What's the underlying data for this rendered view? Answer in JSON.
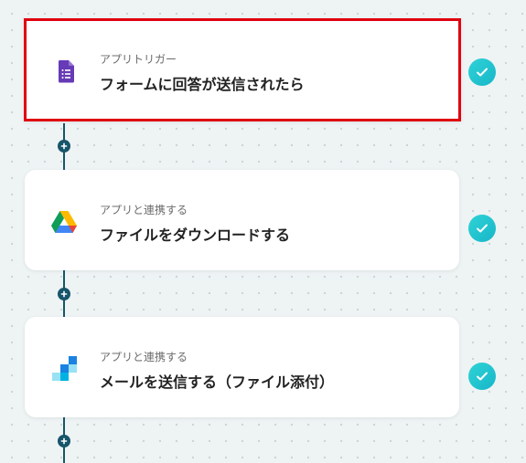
{
  "steps": [
    {
      "sub": "アプリトリガー",
      "title": "フォームに回答が送信されたら",
      "icon": "google-forms-icon",
      "status": "completed"
    },
    {
      "sub": "アプリと連携する",
      "title": "ファイルをダウンロードする",
      "icon": "google-drive-icon",
      "status": "completed"
    },
    {
      "sub": "アプリと連携する",
      "title": "メールを送信する（ファイル添付）",
      "icon": "sendgrid-icon",
      "status": "completed"
    }
  ],
  "colors": {
    "connector": "#17556a",
    "check": "#22c4cf",
    "selected_border": "#e0000f",
    "forms_purple": "#673ab7"
  }
}
